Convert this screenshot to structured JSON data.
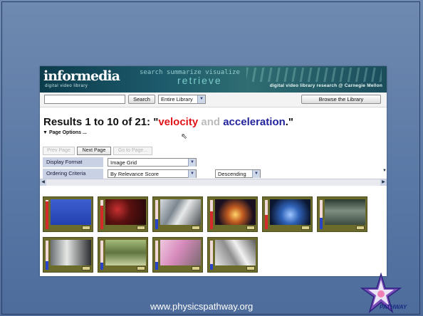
{
  "banner": {
    "logo": "informedia",
    "logo_sub": "digital video library",
    "overlay_words": "search  summarize  visualize",
    "overlay_retrieve": "retrieve",
    "tagline": "digital video library research @ Carnegie Mellon"
  },
  "search": {
    "input_value": "",
    "search_label": "Search",
    "scope_value": "Entire Library",
    "browse_label": "Browse the Library"
  },
  "results": {
    "prefix": "Results 1 to 10 of 21: \"",
    "term1": "velocity",
    "connector": " and ",
    "term2": "acceleration",
    "suffix": ".\""
  },
  "page_options_label": "Page Options ...",
  "pager": {
    "prev_label": "Prev Page",
    "next_label": "Next Page",
    "goto_label": "Go to Page..."
  },
  "options": {
    "display_format_label": "Display Format",
    "display_format_value": "Image Grid",
    "ordering_label": "Ordering Criteria",
    "ordering_value": "By Relevance Score",
    "direction_value": "Descending"
  },
  "thumbnails": [
    {
      "relevance": 0.95,
      "bar_color": "#d42a2a",
      "image": "blue-slide"
    },
    {
      "relevance": 0.8,
      "bar_color": "#d42a2a",
      "image": "presenter-red-stage"
    },
    {
      "relevance": 0.35,
      "bar_color": "#2a44c8",
      "image": "car-machinery"
    },
    {
      "relevance": 0.6,
      "bar_color": "#d42a2a",
      "image": "glowing-stage"
    },
    {
      "relevance": 0.5,
      "bar_color": "#d42a2a",
      "image": "blue-stage"
    },
    {
      "relevance": 0.4,
      "bar_color": "#2a44c8",
      "image": "corridor"
    },
    {
      "relevance": 0.3,
      "bar_color": "#2a44c8",
      "image": "person-dark"
    },
    {
      "relevance": 0.25,
      "bar_color": "#2a44c8",
      "image": "green-scene"
    },
    {
      "relevance": 0.28,
      "bar_color": "#2a44c8",
      "image": "pink-scene"
    },
    {
      "relevance": 0.2,
      "bar_color": "#2a44c8",
      "image": "gray-machinery"
    }
  ],
  "footer": {
    "url": "www.physicspathway.org",
    "logo_text": "PATHWAY"
  }
}
